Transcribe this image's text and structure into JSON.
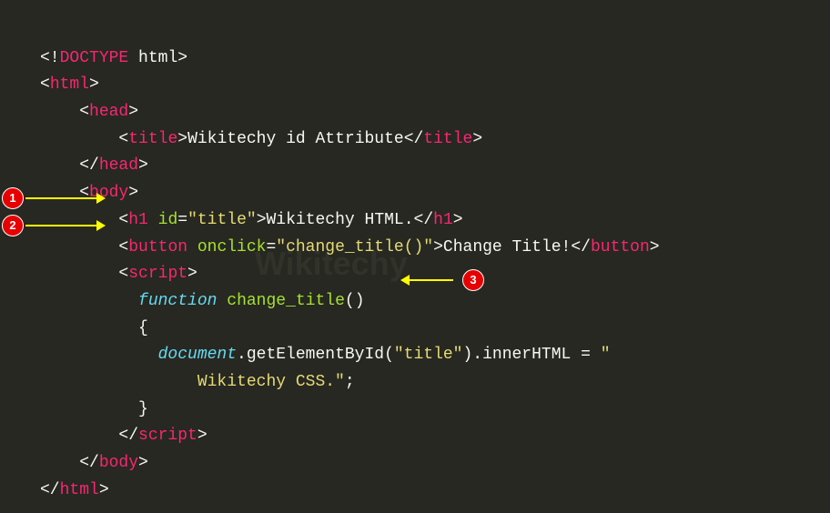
{
  "badges": {
    "b1": "1",
    "b2": "2",
    "b3": "3"
  },
  "code": {
    "l1_a": "<!",
    "l1_b": "DOCTYPE",
    "l1_c": " html",
    "l1_d": ">",
    "l2_a": "<",
    "l2_b": "html",
    "l2_c": ">",
    "l3_a": "<",
    "l3_b": "head",
    "l3_c": ">",
    "l4_a": "<",
    "l4_b": "title",
    "l4_c": ">",
    "l4_d": "Wikitechy id Attribute",
    "l4_e": "</",
    "l4_f": "title",
    "l4_g": ">",
    "l5_a": "</",
    "l5_b": "head",
    "l5_c": ">",
    "l6_a": "<",
    "l6_b": "body",
    "l6_c": ">",
    "l7_a": "<",
    "l7_b": "h1",
    "l7_c": " id",
    "l7_d": "=",
    "l7_e": "\"title\"",
    "l7_f": ">",
    "l7_g": "Wikitechy HTML.",
    "l7_h": "</",
    "l7_i": "h1",
    "l7_j": ">",
    "l8_a": "<",
    "l8_b": "button",
    "l8_c": " onclick",
    "l8_d": "=",
    "l8_e": "\"change_title()\"",
    "l8_f": ">",
    "l8_g": "Change Title!",
    "l8_h": "</",
    "l8_i": "button",
    "l8_j": ">",
    "l9_a": "<",
    "l9_b": "script",
    "l9_c": ">",
    "l10_a": "function",
    "l10_b": " ",
    "l10_c": "change_title",
    "l10_d": "()",
    "l11_a": "{",
    "l12_a": "document",
    "l12_b": ".getElementById(",
    "l12_c": "\"title\"",
    "l12_d": ").innerHTML = ",
    "l12_e": "\"",
    "l13_a": "Wikitechy CSS.\"",
    "l13_b": ";",
    "l14_a": "}",
    "l15_a": "</",
    "l15_b": "script",
    "l15_c": ">",
    "l16_a": "</",
    "l16_b": "body",
    "l16_c": ">",
    "l17_a": "</",
    "l17_b": "html",
    "l17_c": ">"
  },
  "watermark": "Wikitechy"
}
